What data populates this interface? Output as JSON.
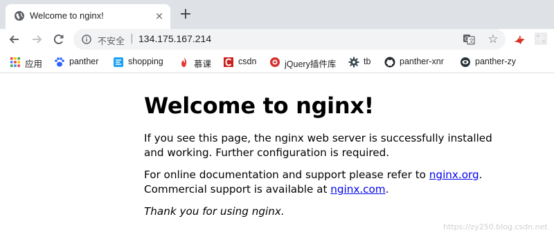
{
  "tab": {
    "title": "Welcome to nginx!",
    "favicon": "globe-icon",
    "close_icon": "×",
    "new_tab_icon": "+"
  },
  "toolbar": {
    "security_label": "不安全",
    "separator": "|",
    "url": "134.175.167.214"
  },
  "bookmarks": [
    {
      "label": "应用",
      "icon": "apps-grid-icon"
    },
    {
      "label": "panther",
      "icon": "paw-icon"
    },
    {
      "label": "shopping",
      "icon": "shopping-icon"
    },
    {
      "label": "慕课",
      "icon": "flame-icon"
    },
    {
      "label": "csdn",
      "icon": "csdn-icon"
    },
    {
      "label": "jQuery插件库",
      "icon": "jquery-icon"
    },
    {
      "label": "tb",
      "icon": "gear-icon"
    },
    {
      "label": "panther-xnr",
      "icon": "github-icon"
    },
    {
      "label": "panther-zy",
      "icon": "eye-circle-icon"
    }
  ],
  "page": {
    "heading": "Welcome to nginx!",
    "p1": "If you see this page, the nginx web server is successfully installed and working. Further configuration is required.",
    "p2_prefix": "For online documentation and support please refer to ",
    "p2_link1": "nginx.org",
    "p2_mid": ".",
    "p2_line2_prefix": "Commercial support is available at ",
    "p2_link2": "nginx.com",
    "p2_suffix": ".",
    "p3": "Thank you for using nginx."
  },
  "watermark": "https://zy250.blog.csdn.net",
  "colors": {
    "tabstrip_bg": "#dee1e6",
    "omnibox_bg": "#f1f3f4",
    "link": "#0000ee"
  }
}
